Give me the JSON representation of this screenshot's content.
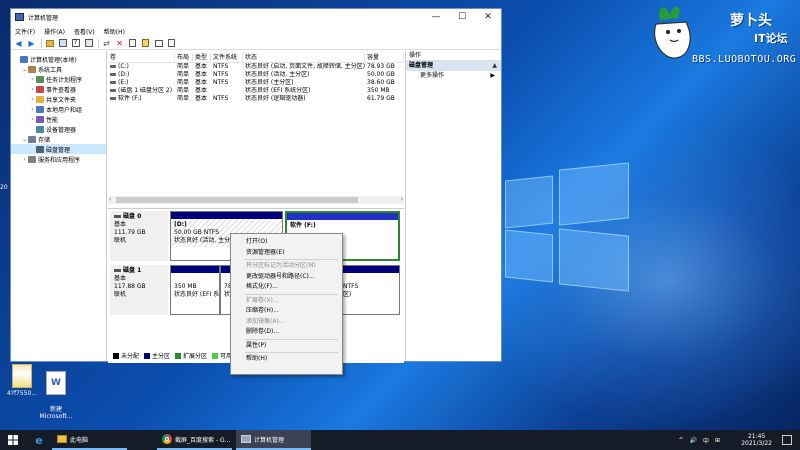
{
  "watermark": {
    "title": "萝卜头",
    "subtitle": "IT论坛",
    "url": "BBS.LUOBOTOU.ORG"
  },
  "desktop": {
    "side_text": "20",
    "icons": [
      {
        "label": "4?f7550...",
        "icon": "image-file-icon"
      },
      {
        "label": "新建\nMicrosoft...",
        "icon": "word-document-icon"
      }
    ]
  },
  "window": {
    "title": "计算机管理",
    "controls": {
      "minimize": "—",
      "maximize": "☐",
      "close": "✕"
    },
    "menu": [
      "文件(F)",
      "操作(A)",
      "查看(V)",
      "帮助(H)"
    ],
    "toolbar": [
      "back-icon",
      "forward-icon",
      "up-icon",
      "show-hide-tree-icon",
      "help-icon",
      "properties-icon",
      "delete-icon",
      "check-icon",
      "export-icon",
      "refresh-icon",
      "new-icon"
    ],
    "tree": [
      {
        "label": "计算机管理(本地)",
        "indent": 0,
        "arrow": "",
        "icon": "computer-management-icon",
        "color": "#4a78c0"
      },
      {
        "label": "系统工具",
        "indent": 1,
        "arrow": "⌄",
        "icon": "tools-icon",
        "color": "#b0814a"
      },
      {
        "label": "任务计划程序",
        "indent": 2,
        "arrow": "›",
        "icon": "clock-icon",
        "color": "#5a8a5a"
      },
      {
        "label": "事件查看器",
        "indent": 2,
        "arrow": "›",
        "icon": "event-viewer-icon",
        "color": "#c04a4a"
      },
      {
        "label": "共享文件夹",
        "indent": 2,
        "arrow": "›",
        "icon": "shared-folder-icon",
        "color": "#e0b040"
      },
      {
        "label": "本地用户和组",
        "indent": 2,
        "arrow": "›",
        "icon": "users-icon",
        "color": "#4a78c0"
      },
      {
        "label": "性能",
        "indent": 2,
        "arrow": "›",
        "icon": "performance-icon",
        "color": "#7a5ab0"
      },
      {
        "label": "设备管理器",
        "indent": 2,
        "arrow": "",
        "icon": "device-manager-icon",
        "color": "#4a8aa0"
      },
      {
        "label": "存储",
        "indent": 1,
        "arrow": "⌄",
        "icon": "storage-icon",
        "color": "#708090"
      },
      {
        "label": "磁盘管理",
        "indent": 2,
        "arrow": "",
        "icon": "disk-management-icon",
        "color": "#506070",
        "selected": true
      },
      {
        "label": "服务和应用程序",
        "indent": 1,
        "arrow": "›",
        "icon": "services-icon",
        "color": "#808080"
      }
    ],
    "volume_table": {
      "headers": [
        "卷",
        "布局",
        "类型",
        "文件系统",
        "状态",
        "容量"
      ],
      "rows": [
        [
          "(C:)",
          "简单",
          "基本",
          "NTFS",
          "状态良好 (启动, 页面文件, 故障转储, 主分区)",
          "78.93 GB"
        ],
        [
          "(D:)",
          "简单",
          "基本",
          "NTFS",
          "状态良好 (活动, 主分区)",
          "50.00 GB"
        ],
        [
          "(E:)",
          "简单",
          "基本",
          "NTFS",
          "状态良好 (主分区)",
          "38.60 GB"
        ],
        [
          "(磁盘 1 磁盘分区 2)",
          "简单",
          "基本",
          "",
          "状态良好 (EFI 系统分区)",
          "350 MB"
        ],
        [
          "软件 (F:)",
          "简单",
          "基本",
          "NTFS",
          "状态良好 (逻辑驱动器)",
          "61.79 GB"
        ]
      ]
    },
    "disks": [
      {
        "name": "磁盘 0",
        "type": "基本",
        "size": "111.79 GB",
        "status": "联机",
        "partitions": [
          {
            "name": "(D:)",
            "size": "50.00 GB NTFS",
            "status": "状态良好 (活动, 主分",
            "style": "hatch"
          },
          {
            "name": "软件 (F:)",
            "size": "",
            "status": "",
            "style": "green"
          }
        ]
      },
      {
        "name": "磁盘 1",
        "type": "基本",
        "size": "117.88 GB",
        "status": "联机",
        "partitions": [
          {
            "name": "",
            "size": "350 MB",
            "status": "状态良好 (EFI 系",
            "style": "normal"
          },
          {
            "name": "",
            "size": "78",
            "status": "状",
            "style": "normal"
          },
          {
            "name": "",
            "size": "NTFS",
            "status": "区)",
            "style": "normal"
          }
        ]
      }
    ],
    "legend": [
      {
        "label": "未分配",
        "color": "#000000"
      },
      {
        "label": "主分区",
        "color": "#00007a"
      },
      {
        "label": "扩展分区",
        "color": "#2a8a2a"
      },
      {
        "label": "可用空",
        "color": "#4ccc4c"
      }
    ],
    "actions": {
      "header": "操作",
      "section": "磁盘管理",
      "section_arrow": "▲",
      "more": "更多操作",
      "more_arrow": "▶"
    }
  },
  "context_menu": [
    {
      "label": "打开(O)",
      "enabled": true
    },
    {
      "label": "资源管理器(E)",
      "enabled": true
    },
    {
      "sep": true
    },
    {
      "label": "将分区标记为活动分区(M)",
      "enabled": false
    },
    {
      "label": "更改驱动器号和路径(C)...",
      "enabled": true
    },
    {
      "label": "格式化(F)...",
      "enabled": true
    },
    {
      "sep": true
    },
    {
      "label": "扩展卷(X)...",
      "enabled": false
    },
    {
      "label": "压缩卷(H)...",
      "enabled": true
    },
    {
      "label": "添加镜像(A)...",
      "enabled": false
    },
    {
      "label": "删除卷(D)...",
      "enabled": true
    },
    {
      "sep": true
    },
    {
      "label": "属性(P)",
      "enabled": true
    },
    {
      "sep": true
    },
    {
      "label": "帮助(H)",
      "enabled": true
    }
  ],
  "taskbar": {
    "apps": [
      {
        "label": "此电脑",
        "icon": "folder-icon"
      },
      {
        "label": "截屏_百度搜索 - G...",
        "icon": "chrome-icon"
      },
      {
        "label": "计算机管理",
        "icon": "computer-management-icon"
      }
    ],
    "tray": [
      "^",
      "🔊",
      "中",
      "⊞"
    ],
    "time": "21:45",
    "date": "2021/3/22"
  }
}
